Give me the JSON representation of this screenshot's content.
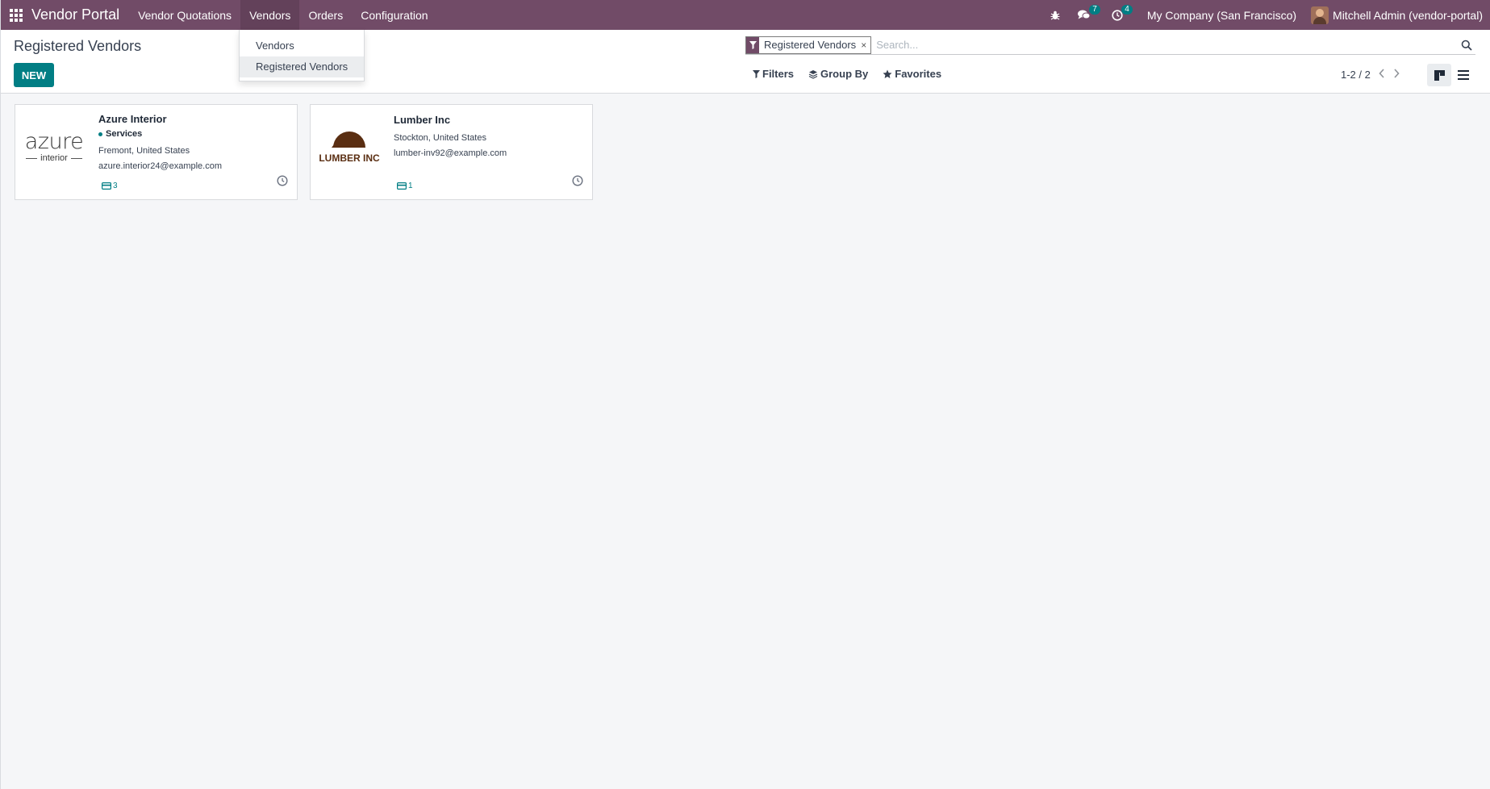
{
  "navbar": {
    "brand": "Vendor Portal",
    "menu": [
      "Vendor Quotations",
      "Vendors",
      "Orders",
      "Configuration"
    ],
    "messages_count": "7",
    "activities_count": "4",
    "company": "My Company (San Francisco)",
    "user": "Mitchell Admin (vendor-portal)"
  },
  "dropdown": {
    "items": [
      "Vendors",
      "Registered Vendors"
    ]
  },
  "control_panel": {
    "title": "Registered Vendors",
    "new_label": "NEW",
    "facet": "Registered Vendors",
    "facet_remove": "×",
    "search_placeholder": "Search...",
    "filters_label": "Filters",
    "groupby_label": "Group By",
    "favorites_label": "Favorites",
    "pager": "1-2 / 2"
  },
  "cards": [
    {
      "name": "Azure Interior",
      "tag": "Services",
      "location": "Fremont, United States",
      "email": "azure.interior24@example.com",
      "count": "3",
      "logo_main": "azure",
      "logo_sub": "interior"
    },
    {
      "name": "Lumber Inc",
      "location": "Stockton, United States",
      "email": "lumber-inv92@example.com",
      "count": "1",
      "logo_main": "LUMBER INC"
    }
  ],
  "colors": {
    "navbar": "#714b67",
    "primary": "#017e84",
    "background": "#f5f6f8"
  }
}
